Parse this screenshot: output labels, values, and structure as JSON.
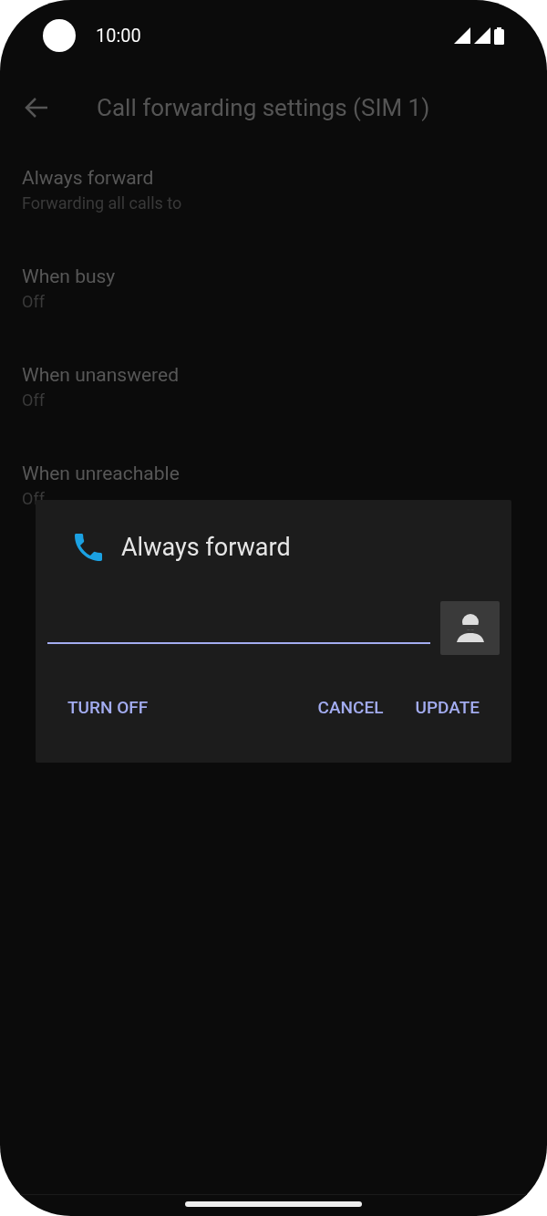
{
  "status_bar": {
    "time": "10:00"
  },
  "header": {
    "title": "Call forwarding settings (SIM 1)"
  },
  "settings": [
    {
      "title": "Always forward",
      "subtitle": "Forwarding all calls to"
    },
    {
      "title": "When busy",
      "subtitle": "Off"
    },
    {
      "title": "When unanswered",
      "subtitle": "Off"
    },
    {
      "title": "When unreachable",
      "subtitle": "Off"
    }
  ],
  "dialog": {
    "title": "Always forward",
    "buttons": [
      {
        "label": "TURN OFF"
      },
      {
        "label": "CANCEL"
      },
      {
        "label": "UPDATE"
      }
    ]
  }
}
